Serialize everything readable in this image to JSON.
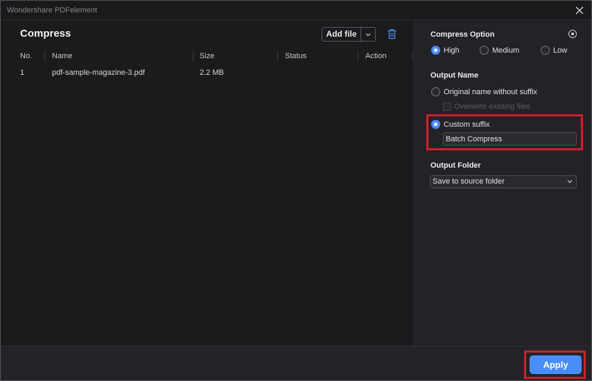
{
  "window": {
    "title": "Wondershare PDFelement"
  },
  "main": {
    "heading": "Compress",
    "add_file_label": "Add file",
    "columns": [
      "No.",
      "Name",
      "Size",
      "Status",
      "Action"
    ],
    "rows": [
      {
        "no": "1",
        "name": "pdf-sample-magazine-3.pdf",
        "size": "2.2 MB",
        "status": "",
        "action": ""
      }
    ]
  },
  "side": {
    "compress_option": {
      "title": "Compress Option",
      "options": [
        "High",
        "Medium",
        "Low"
      ],
      "selected": "High"
    },
    "output_name": {
      "title": "Output Name",
      "original_label": "Original name without suffix",
      "overwrite_label": "Overwrite existing files",
      "custom_label": "Custom suffix",
      "custom_value": "Batch Compress",
      "selected": "Custom suffix"
    },
    "output_folder": {
      "title": "Output Folder",
      "selected": "Save to source folder"
    }
  },
  "footer": {
    "apply_label": "Apply"
  },
  "colors": {
    "accent": "#4b8df8",
    "highlight": "#d0202a"
  },
  "icons": [
    "close-icon",
    "chevron-down-icon",
    "trash-icon",
    "info-icon"
  ]
}
